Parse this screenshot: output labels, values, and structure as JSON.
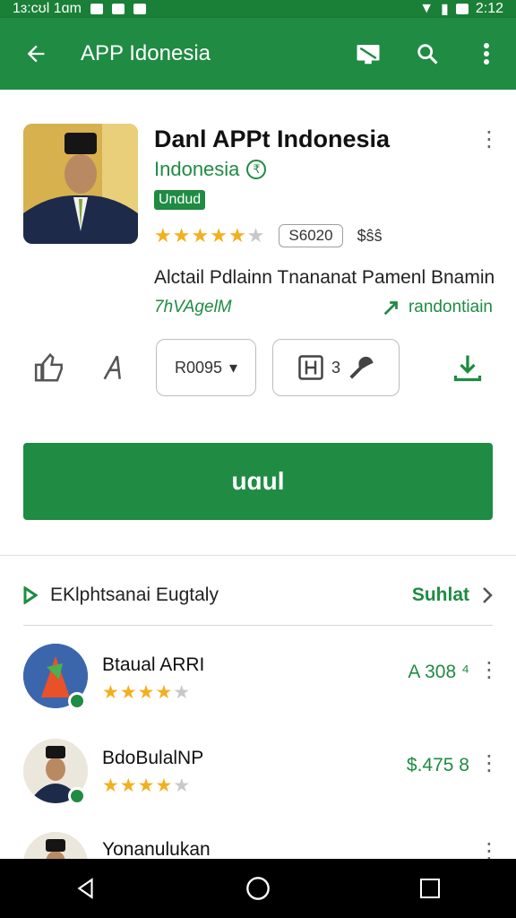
{
  "status_bar": {
    "time_left": "1ɜ:cʊl 1ɑm",
    "time_right": "2:12"
  },
  "app_bar": {
    "title": "APP Idonesia"
  },
  "app": {
    "name": "Danl APPt Indonesia",
    "developer": "Indonesia",
    "developer_badge": "ⓡ",
    "tag": "Undud",
    "rating_stars": 4.5,
    "downloads_chip": "S6020",
    "chip_aux": "$ŝŝ",
    "headline": "Alctail Pdlainn Tnananat Pamenl Bnamin",
    "subline_left": "7hVAgelM",
    "subline_right": "randontiain",
    "size_dropdown": "R0095",
    "count_value": "3",
    "install_label": "uɑul"
  },
  "section": {
    "title": "EKlphtsanai Eugtaly",
    "more_label": "Suhlat"
  },
  "list": [
    {
      "name": "Btaual ARRI",
      "stars": 4,
      "price": "A 308 ⁴"
    },
    {
      "name": "BdoBulalNP",
      "stars": 4,
      "price": "$.475 8"
    },
    {
      "name": "Yonanulukan",
      "stars": 0,
      "price": ""
    }
  ],
  "colors": {
    "brand": "#1f8b43",
    "star": "#f2b01e"
  }
}
